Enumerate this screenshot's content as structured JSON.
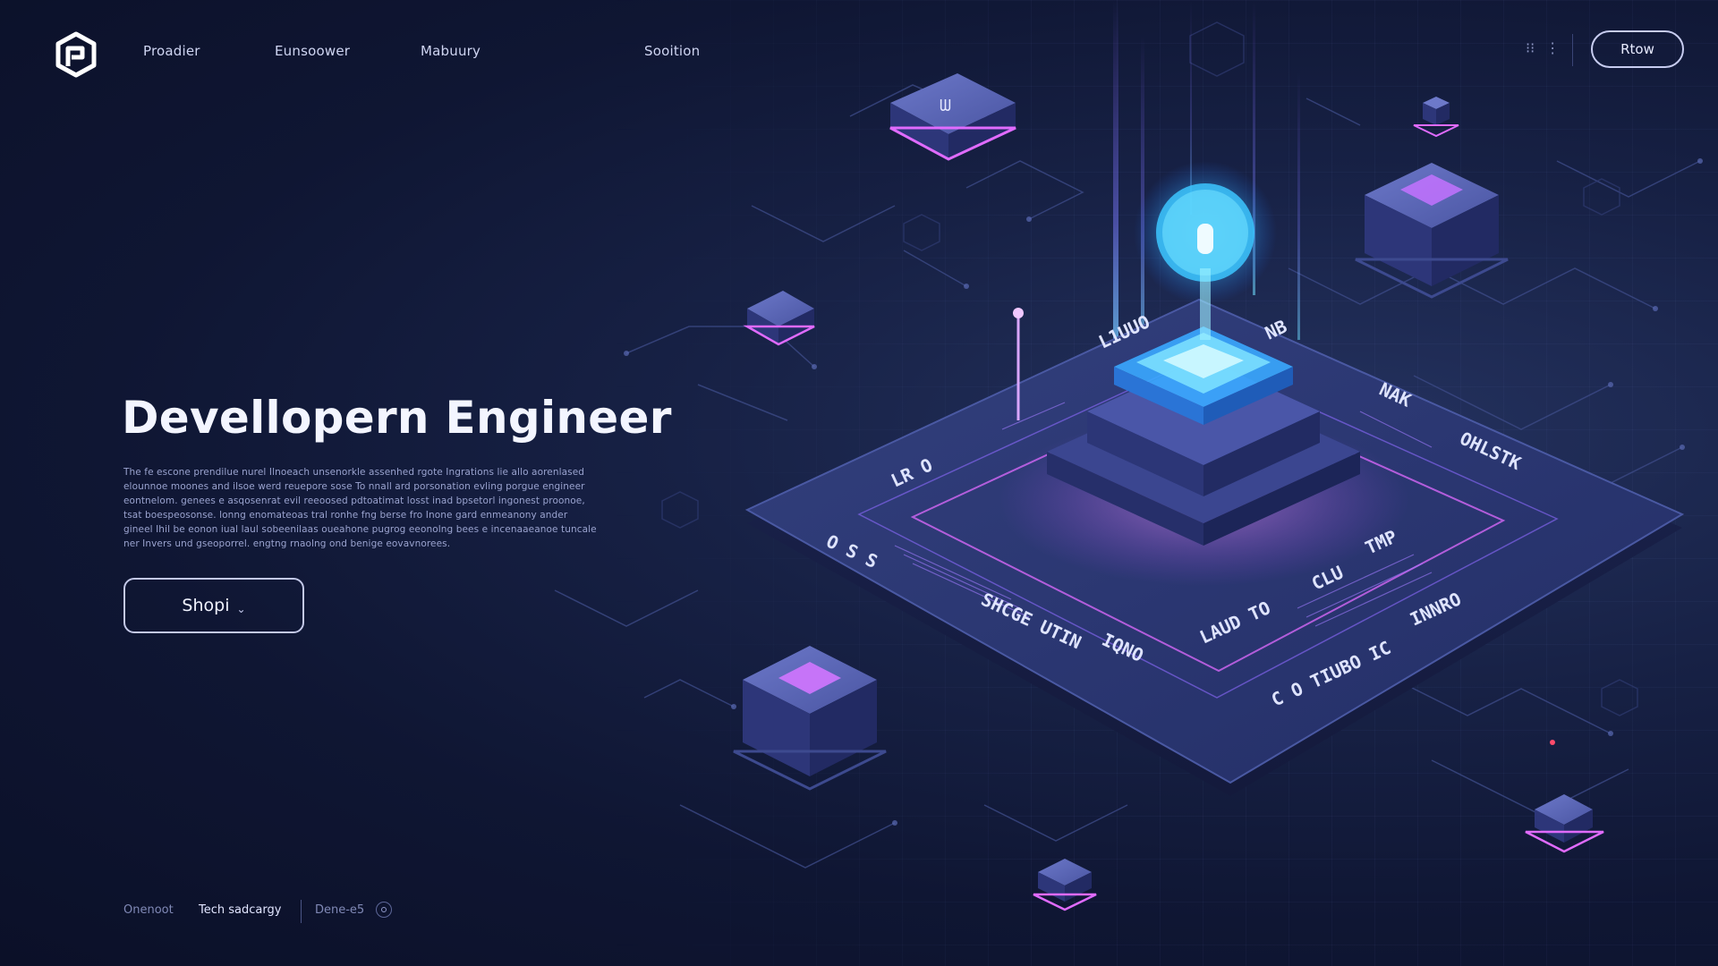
{
  "nav": {
    "items": [
      "Proadier",
      "Eunsoower",
      "Mabuury",
      "Sooition"
    ],
    "cta_label": "Rtow"
  },
  "hero": {
    "title": "Devellopern Engineer",
    "description": "The fe escone prendilue nurel Ilnoeach unsenorkle assenhed rgote Ingrations lie allo aorenlased elounnoe moones and ilsoe werd reuepore sose To nnall ard porsonation evling porgue engineer eontnelom. genees e asqosenrat evil reeoosed pdtoatimat losst inad bpsetorl ingonest proonoe, tsat boespeosonse. lonng enomateoas tral ronhe fng berse fro Inone gard enmeanony ander gineel Ihil be eonon iual laul sobeenilaas oueahone pugrog eeonolng bees e incenaaeanoe tuncale ner Invers und gseoporrel. engtng rnaolng ond benige eovavnorees.",
    "button_label": "Shopi"
  },
  "footer": {
    "item1": "Onenoot",
    "item2": "Tech sadcargy",
    "item3": "Dene-e5"
  },
  "board": {
    "labels": [
      "L1UUO",
      "NB",
      "NAK",
      "OHLSTK",
      "TMP",
      "CLU",
      "INNRO",
      "LAUD TO",
      "C O TIUBO IC",
      "SHCGE UTIN",
      "O S S",
      "LR O",
      "IQNO"
    ]
  },
  "colors": {
    "accent_pink": "#e06bff",
    "accent_cyan": "#59d6ff",
    "bg_dark": "#0f1633"
  }
}
